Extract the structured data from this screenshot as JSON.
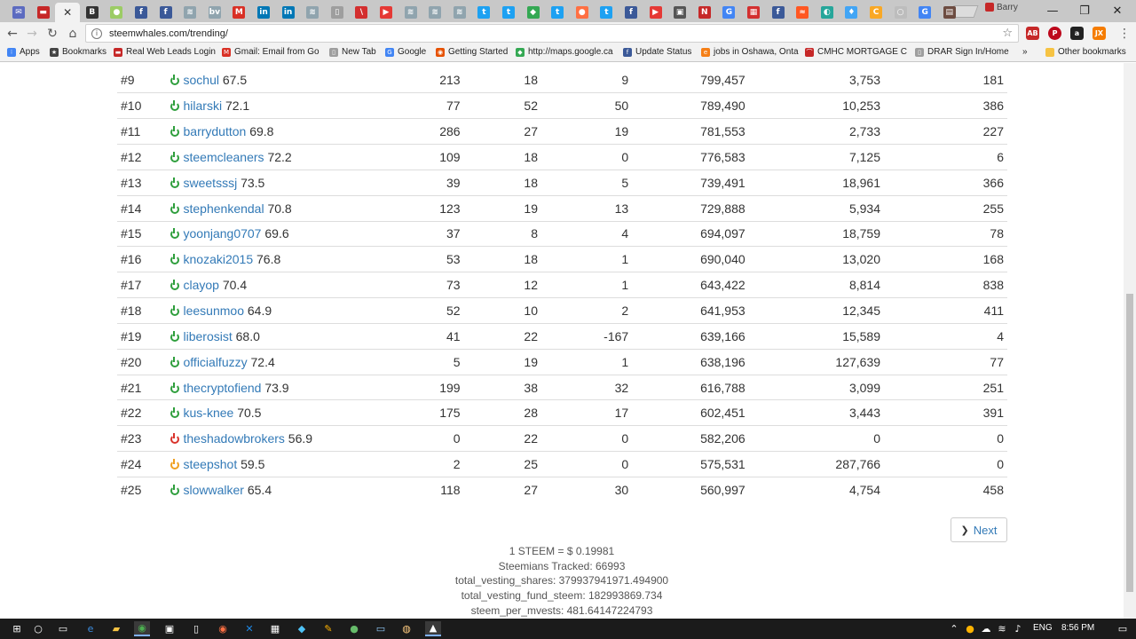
{
  "browser": {
    "url": "steemwhales.com/trending/",
    "profile_name": "Barry",
    "tabs": [
      {
        "icon": "mail-icon",
        "color": "#5c6bc0",
        "glyph": "✉"
      },
      {
        "icon": "car-icon",
        "color": "#c62828",
        "glyph": "▬"
      },
      {
        "icon": "close-icon",
        "color": "",
        "glyph": "✕",
        "active": true
      },
      {
        "icon": "b-icon",
        "color": "#333333",
        "glyph": "B"
      },
      {
        "icon": "coin-icon",
        "color": "#9ccc65",
        "glyph": "●"
      },
      {
        "icon": "facebook-icon",
        "color": "#3b5998",
        "glyph": "f"
      },
      {
        "icon": "facebook-icon",
        "color": "#3b5998",
        "glyph": "f"
      },
      {
        "icon": "steem-icon",
        "color": "#90a4ae",
        "glyph": "≋"
      },
      {
        "icon": "bv-icon",
        "color": "#90a4ae",
        "glyph": "bv"
      },
      {
        "icon": "gmail-icon",
        "color": "#d93025",
        "glyph": "M"
      },
      {
        "icon": "linkedin-icon",
        "color": "#0077b5",
        "glyph": "in"
      },
      {
        "icon": "linkedin-icon",
        "color": "#0077b5",
        "glyph": "in"
      },
      {
        "icon": "steem-icon",
        "color": "#90a4ae",
        "glyph": "≋"
      },
      {
        "icon": "document-icon",
        "color": "#9e9e9e",
        "glyph": "▯"
      },
      {
        "icon": "slash-icon",
        "color": "#d32f2f",
        "glyph": "\\"
      },
      {
        "icon": "youtube-icon",
        "color": "#e53935",
        "glyph": "▶"
      },
      {
        "icon": "steem-icon",
        "color": "#90a4ae",
        "glyph": "≋"
      },
      {
        "icon": "steem-icon",
        "color": "#90a4ae",
        "glyph": "≋"
      },
      {
        "icon": "steem-icon",
        "color": "#90a4ae",
        "glyph": "≋"
      },
      {
        "icon": "twitter-icon",
        "color": "#1da1f2",
        "glyph": "t"
      },
      {
        "icon": "twitter-icon",
        "color": "#1da1f2",
        "glyph": "t"
      },
      {
        "icon": "maps-icon",
        "color": "#34a853",
        "glyph": "◆"
      },
      {
        "icon": "twitter-icon",
        "color": "#1da1f2",
        "glyph": "t"
      },
      {
        "icon": "orange-circle-icon",
        "color": "#ff7043",
        "glyph": "●"
      },
      {
        "icon": "twitter-icon",
        "color": "#1da1f2",
        "glyph": "t"
      },
      {
        "icon": "facebook-icon",
        "color": "#3b5998",
        "glyph": "f"
      },
      {
        "icon": "youtube-icon",
        "color": "#e53935",
        "glyph": "▶"
      },
      {
        "icon": "box-icon",
        "color": "#555555",
        "glyph": "▣"
      },
      {
        "icon": "news-icon",
        "color": "#c62828",
        "glyph": "N"
      },
      {
        "icon": "google-icon",
        "color": "#4285f4",
        "glyph": "G"
      },
      {
        "icon": "grid-icon",
        "color": "#d32f2f",
        "glyph": "▦"
      },
      {
        "icon": "facebook-icon",
        "color": "#3b5998",
        "glyph": "f"
      },
      {
        "icon": "soundcloud-icon",
        "color": "#ff5722",
        "glyph": "≈"
      },
      {
        "icon": "teal-icon",
        "color": "#26a69a",
        "glyph": "◐"
      },
      {
        "icon": "drop-icon",
        "color": "#42a5f5",
        "glyph": "♦"
      },
      {
        "icon": "c-icon",
        "color": "#f9a825",
        "glyph": "C"
      },
      {
        "icon": "circle-icon",
        "color": "#bdbdbd",
        "glyph": "○"
      },
      {
        "icon": "google-icon",
        "color": "#4285f4",
        "glyph": "G"
      },
      {
        "icon": "page-icon",
        "color": "#6d4c41",
        "glyph": "▤"
      }
    ],
    "bookmarks": [
      {
        "label": "Apps",
        "icon": "apps-grid-icon",
        "color": "#4285f4",
        "glyph": "⁝"
      },
      {
        "label": "Bookmarks",
        "icon": "star-icon",
        "color": "#444444",
        "glyph": "★"
      },
      {
        "label": "Real Web Leads Login",
        "icon": "car-icon",
        "color": "#c62828",
        "glyph": "▬"
      },
      {
        "label": "Gmail: Email from Go",
        "icon": "gmail-icon",
        "color": "#d93025",
        "glyph": "M"
      },
      {
        "label": "New Tab",
        "icon": "page-icon",
        "color": "#9e9e9e",
        "glyph": "▯"
      },
      {
        "label": "Google",
        "icon": "google-icon",
        "color": "#4285f4",
        "glyph": "G"
      },
      {
        "label": "Getting Started",
        "icon": "firefox-icon",
        "color": "#e65100",
        "glyph": "◉"
      },
      {
        "label": "http://maps.google.ca",
        "icon": "maps-icon",
        "color": "#34a853",
        "glyph": "◆"
      },
      {
        "label": "Update Status",
        "icon": "facebook-icon",
        "color": "#3b5998",
        "glyph": "f"
      },
      {
        "label": "jobs in Oshawa, Onta",
        "icon": "e-icon",
        "color": "#f57f17",
        "glyph": "e"
      },
      {
        "label": "CMHC MORTGAGE C",
        "icon": "cmhc-icon",
        "color": "#c62828",
        "glyph": "⌒"
      },
      {
        "label": "DRAR Sign In/Home",
        "icon": "page-icon",
        "color": "#9e9e9e",
        "glyph": "▯"
      }
    ],
    "bookmarks_overflow": "»",
    "other_bookmarks": "Other bookmarks"
  },
  "table": {
    "rows": [
      {
        "rank": "#9",
        "name": "sochul",
        "score": "67.5",
        "status": "green",
        "a": "213",
        "b": "18",
        "c": "9",
        "d": "799,457",
        "e": "3,753",
        "f": "181"
      },
      {
        "rank": "#10",
        "name": "hilarski",
        "score": "72.1",
        "status": "green",
        "a": "77",
        "b": "52",
        "c": "50",
        "d": "789,490",
        "e": "10,253",
        "f": "386"
      },
      {
        "rank": "#11",
        "name": "barrydutton",
        "score": "69.8",
        "status": "green",
        "a": "286",
        "b": "27",
        "c": "19",
        "d": "781,553",
        "e": "2,733",
        "f": "227"
      },
      {
        "rank": "#12",
        "name": "steemcleaners",
        "score": "72.2",
        "status": "green",
        "a": "109",
        "b": "18",
        "c": "0",
        "d": "776,583",
        "e": "7,125",
        "f": "6"
      },
      {
        "rank": "#13",
        "name": "sweetsssj",
        "score": "73.5",
        "status": "green",
        "a": "39",
        "b": "18",
        "c": "5",
        "d": "739,491",
        "e": "18,961",
        "f": "366"
      },
      {
        "rank": "#14",
        "name": "stephenkendal",
        "score": "70.8",
        "status": "green",
        "a": "123",
        "b": "19",
        "c": "13",
        "d": "729,888",
        "e": "5,934",
        "f": "255"
      },
      {
        "rank": "#15",
        "name": "yoonjang0707",
        "score": "69.6",
        "status": "green",
        "a": "37",
        "b": "8",
        "c": "4",
        "d": "694,097",
        "e": "18,759",
        "f": "78"
      },
      {
        "rank": "#16",
        "name": "knozaki2015",
        "score": "76.8",
        "status": "green",
        "a": "53",
        "b": "18",
        "c": "1",
        "d": "690,040",
        "e": "13,020",
        "f": "168"
      },
      {
        "rank": "#17",
        "name": "clayop",
        "score": "70.4",
        "status": "green",
        "a": "73",
        "b": "12",
        "c": "1",
        "d": "643,422",
        "e": "8,814",
        "f": "838"
      },
      {
        "rank": "#18",
        "name": "leesunmoo",
        "score": "64.9",
        "status": "green",
        "a": "52",
        "b": "10",
        "c": "2",
        "d": "641,953",
        "e": "12,345",
        "f": "411"
      },
      {
        "rank": "#19",
        "name": "liberosist",
        "score": "68.0",
        "status": "green",
        "a": "41",
        "b": "22",
        "c": "-167",
        "d": "639,166",
        "e": "15,589",
        "f": "4"
      },
      {
        "rank": "#20",
        "name": "officialfuzzy",
        "score": "72.4",
        "status": "green",
        "a": "5",
        "b": "19",
        "c": "1",
        "d": "638,196",
        "e": "127,639",
        "f": "77"
      },
      {
        "rank": "#21",
        "name": "thecryptofiend",
        "score": "73.9",
        "status": "green",
        "a": "199",
        "b": "38",
        "c": "32",
        "d": "616,788",
        "e": "3,099",
        "f": "251"
      },
      {
        "rank": "#22",
        "name": "kus-knee",
        "score": "70.5",
        "status": "green",
        "a": "175",
        "b": "28",
        "c": "17",
        "d": "602,451",
        "e": "3,443",
        "f": "391"
      },
      {
        "rank": "#23",
        "name": "theshadowbrokers",
        "score": "56.9",
        "status": "red",
        "a": "0",
        "b": "22",
        "c": "0",
        "d": "582,206",
        "e": "0",
        "f": "0"
      },
      {
        "rank": "#24",
        "name": "steepshot",
        "score": "59.5",
        "status": "orange",
        "a": "2",
        "b": "25",
        "c": "0",
        "d": "575,531",
        "e": "287,766",
        "f": "0"
      },
      {
        "rank": "#25",
        "name": "slowwalker",
        "score": "65.4",
        "status": "green",
        "a": "118",
        "b": "27",
        "c": "30",
        "d": "560,997",
        "e": "4,754",
        "f": "458"
      }
    ]
  },
  "status_colors": {
    "green": "#2e9e3c",
    "red": "#d9332b",
    "orange": "#f0a020"
  },
  "pagination": {
    "next_label": "Next"
  },
  "footer": {
    "price": "1 STEEM = $ 0.19981",
    "tracked": "Steemians Tracked: 66993",
    "total_vesting_shares": "total_vesting_shares: 379937941971.494900",
    "total_vesting_fund_steem": "total_vesting_fund_steem: 182993869.734",
    "steem_per_mvests": "steem_per_mvests: 481.64147224793"
  },
  "taskbar": {
    "language": "ENG",
    "time": "8:56 PM"
  }
}
